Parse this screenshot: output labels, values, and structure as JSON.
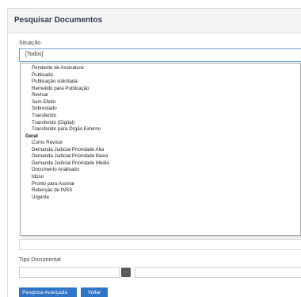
{
  "panel": {
    "title": "Pesquisar Documentos"
  },
  "situacao": {
    "label": "Situação",
    "selected": "[Todos]",
    "options": [
      {
        "label": "Pendente de Assinatura",
        "group": false
      },
      {
        "label": "Publicado",
        "group": false
      },
      {
        "label": "Publicação solicitada",
        "group": false
      },
      {
        "label": "Remetido para Publicação",
        "group": false
      },
      {
        "label": "Revisar",
        "group": false
      },
      {
        "label": "Sem Efeito",
        "group": false
      },
      {
        "label": "Sobrestado",
        "group": false
      },
      {
        "label": "Transferido",
        "group": false
      },
      {
        "label": "Transferido (Digital)",
        "group": false
      },
      {
        "label": "Transferido para Órgão Externo",
        "group": false
      },
      {
        "label": "Geral",
        "group": true
      },
      {
        "label": "Como Revisor",
        "group": false
      },
      {
        "label": "Demanda Judicial Prioridade Alta",
        "group": false
      },
      {
        "label": "Demanda Judicial Prioridade Baixa",
        "group": false
      },
      {
        "label": "Demanda Judicial Prioridade Média",
        "group": false
      },
      {
        "label": "Documento Analisado",
        "group": false
      },
      {
        "label": "Idoso",
        "group": false
      },
      {
        "label": "Pronto para Assinar",
        "group": false
      },
      {
        "label": "Retenção de INSS",
        "group": false
      },
      {
        "label": "Urgente",
        "group": false
      }
    ]
  },
  "tipo_documental": {
    "label": "Tipo Documental",
    "button_label": "..."
  },
  "actions": {
    "advanced_search": "Pesquisa Avançada",
    "back": "Voltar"
  }
}
